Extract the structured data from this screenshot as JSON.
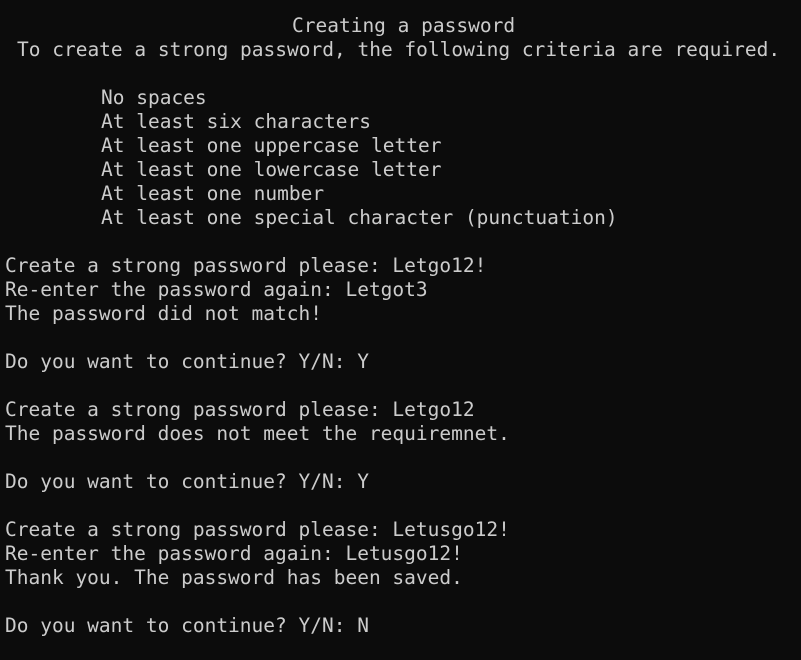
{
  "header": {
    "title": "Creating a password",
    "intro": "To create a strong password, the following criteria are required."
  },
  "criteria": [
    "No spaces",
    "At least six characters",
    "At least one uppercase letter",
    "At least one lowercase letter",
    "At least one number",
    "At least one special character (punctuation)"
  ],
  "session": [
    "Create a strong password please: Letgo12!",
    "Re-enter the password again: Letgot3",
    "The password did not match!",
    "Do you want to continue? Y/N: Y",
    "Create a strong password please: Letgo12",
    "The password does not meet the requiremnet.",
    "Do you want to continue? Y/N: Y",
    "Create a strong password please: Letusgo12!",
    "Re-enter the password again: Letusgo12!",
    "Thank you. The password has been saved.",
    "Do you want to continue? Y/N: N"
  ],
  "colors": {
    "background": "#0c0c0c",
    "text": "#cccccc"
  }
}
